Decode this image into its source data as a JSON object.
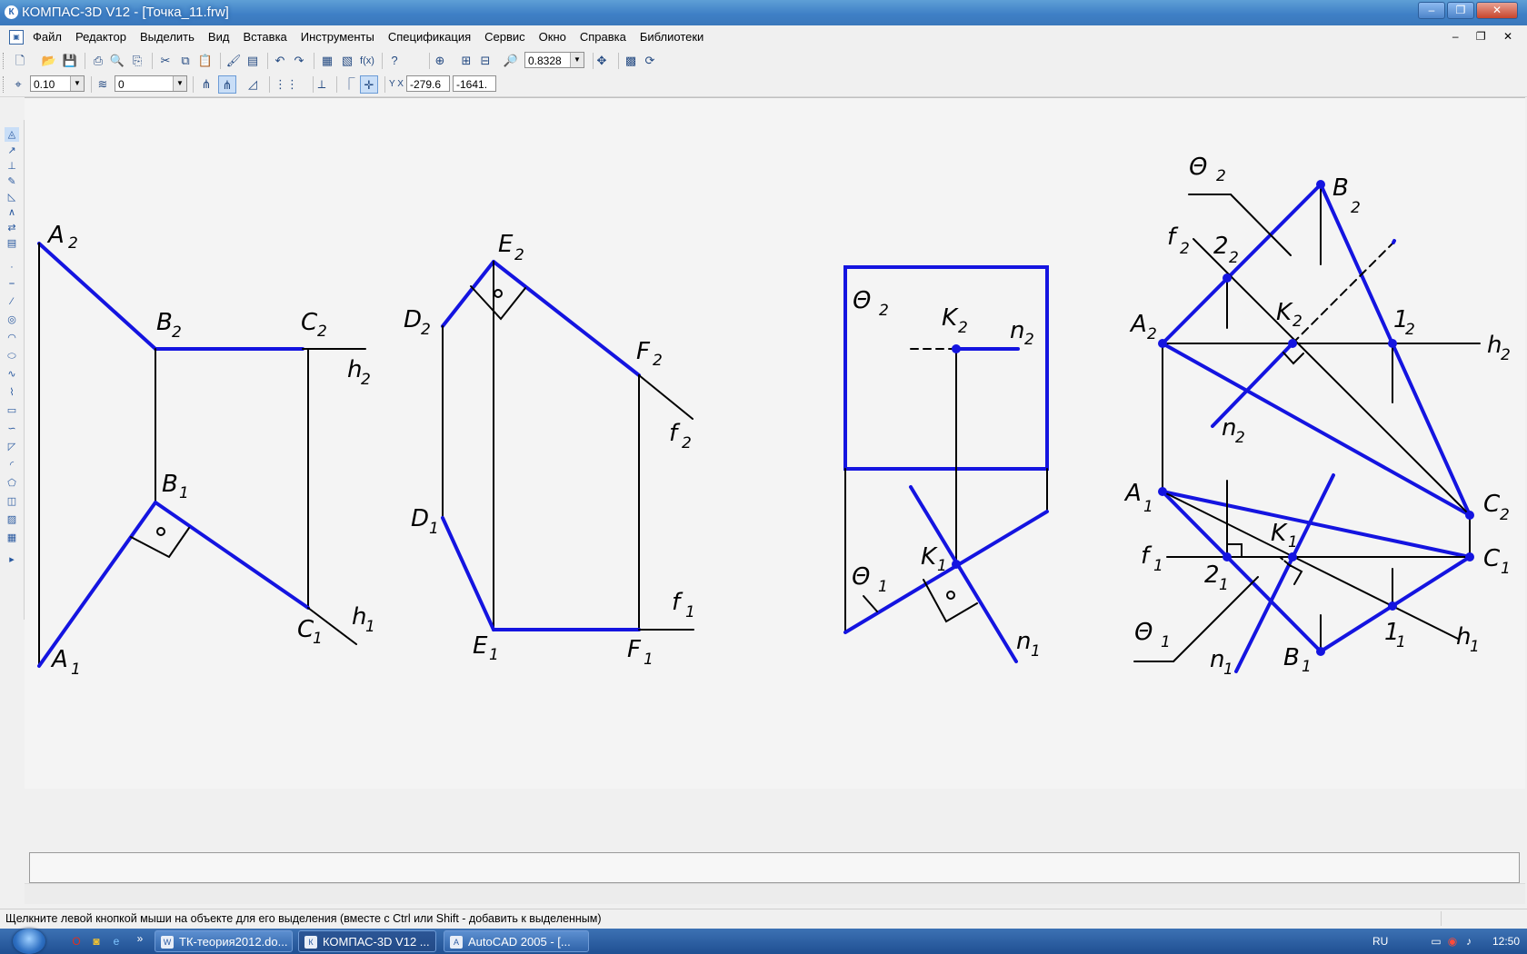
{
  "window": {
    "title": "КОМПАС-3D V12 - [Точка_11.frw]",
    "app_icon": "К",
    "minimize_glyph": "‒",
    "maximize_glyph": "❐",
    "close_glyph": "✕"
  },
  "menu": {
    "items": [
      "Файл",
      "Редактор",
      "Выделить",
      "Вид",
      "Вставка",
      "Инструменты",
      "Спецификация",
      "Сервис",
      "Окно",
      "Справка",
      "Библиотеки"
    ],
    "mdi_controls": "‒ ❐ ✕"
  },
  "toolbar1": {
    "icons": [
      "new-document-icon",
      "open-icon",
      "save-icon",
      "print-icon",
      "print-preview-icon",
      "print-options-icon",
      "cut-icon",
      "copy-icon",
      "paste-icon",
      "properties-brush-icon",
      "list-icon",
      "undo-icon",
      "redo-icon",
      "manager-icon",
      "layers-icon",
      "variables-icon",
      "help-icon",
      "zoom-box-icon",
      "zoom-in-icon",
      "zoom-out-icon",
      "zoom-scale-icon",
      "pan-icon",
      "redraw-icon",
      "refresh-icon"
    ],
    "zoom_value": "0.8328"
  },
  "toolbar2": {
    "step_value": "0.10",
    "layer_value": "0",
    "coord_x": "-279.6",
    "coord_y": "-1641."
  },
  "drawing": {
    "labels": {
      "A2": "A",
      "B2": "B",
      "C2": "C",
      "h2": "h",
      "B1": "B",
      "C1": "C",
      "h1": "h",
      "A1": "A",
      "E2": "E",
      "D2": "D",
      "F2": "F",
      "f2": "f",
      "D1": "D",
      "E1": "E",
      "F1": "F",
      "f1": "f",
      "theta2": "Θ",
      "K2": "K",
      "n2": "n",
      "theta1": "Θ",
      "K1": "K",
      "n1": "n",
      "sub1": "1",
      "sub2": "2",
      "p4_B2": "B",
      "p4_A2": "A",
      "p4_K2": "K",
      "p4_12": "1",
      "p4_h2": "h",
      "p4_22": "2",
      "p4_f2": "f",
      "p4_A1": "A",
      "p4_K1": "K",
      "p4_C2": "C",
      "p4_C1": "C",
      "p4_f1": "f",
      "p4_21": "2",
      "p4_11": "1",
      "p4_h1": "h",
      "p4_B1": "B",
      "p4_n1": "n",
      "p4_n2": "n",
      "p4_theta1": "Θ",
      "p4_theta2": "Θ"
    },
    "colors": {
      "construction": "#1414e0",
      "line": "#000000"
    }
  },
  "status": {
    "message": "Щелкните левой кнопкой мыши на объекте для его выделения (вместе с Ctrl или Shift - добавить к выделенным)"
  },
  "taskbar": {
    "more": "»",
    "tasks": [
      {
        "label": "ТК-теория2012.do...",
        "icon": "W"
      },
      {
        "label": "КОМПАС-3D V12 ...",
        "icon": "К"
      },
      {
        "label": "AutoCAD 2005 - [...",
        "icon": "A"
      }
    ],
    "language": "RU",
    "clock": "12:50"
  }
}
